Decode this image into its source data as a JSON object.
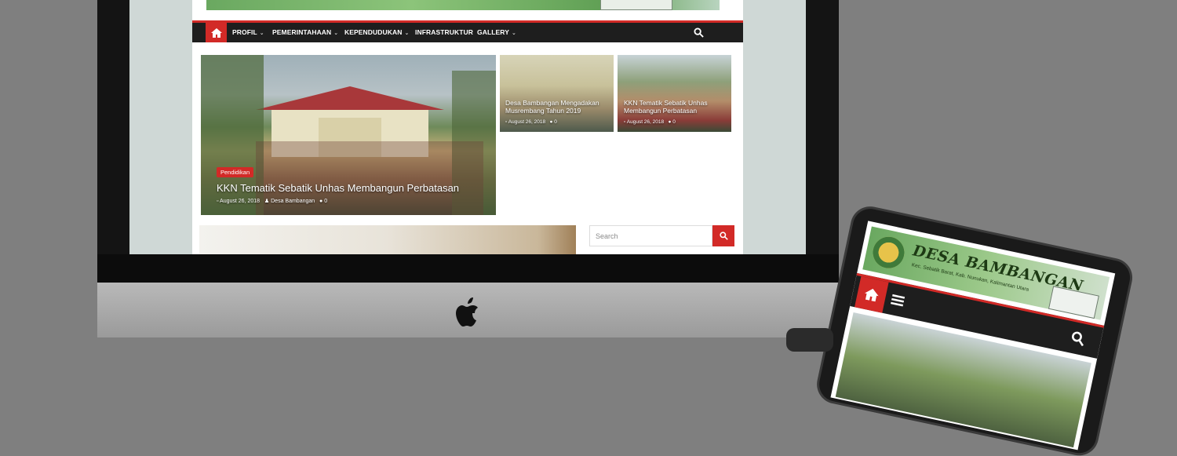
{
  "nav": {
    "items": [
      {
        "label": "PROFIL",
        "dropdown": true
      },
      {
        "label": "PEMERINTAHAAN",
        "dropdown": true
      },
      {
        "label": "KEPENDUDUKAN",
        "dropdown": true
      },
      {
        "label": "INFRASTRUKTUR",
        "dropdown": false
      },
      {
        "label": "GALLERY",
        "dropdown": true
      }
    ],
    "chevron": "⌄"
  },
  "featured": {
    "category": "Pendidikan",
    "title": "KKN Tematik Sebatik Unhas Membangun Perbatasan",
    "date": "August 26, 2018",
    "author": "Desa Bambangan",
    "comments": "0"
  },
  "small_posts": [
    {
      "title": "Desa Bambangan Mengadakan Musrembang Tahun 2019",
      "date": "August 26, 2018",
      "comments": "0"
    },
    {
      "title": "KKN Tematik Sebatik Unhas Membangun Perbatasan",
      "date": "August 26, 2018",
      "comments": "0"
    }
  ],
  "sidebar": {
    "search_placeholder": "Search"
  },
  "tablet": {
    "site_title": "DESA BAMBANGAN",
    "site_subtitle": "Kec. Sebatik Barat, Kab. Nunukan, Kalimantan Utara"
  },
  "colors": {
    "accent": "#d22a27",
    "nav_bg": "#1e1e1e"
  },
  "icons": [
    "home-icon",
    "search-icon",
    "calendar-icon",
    "user-icon",
    "comment-icon",
    "hamburger-menu-icon",
    "apple-logo"
  ]
}
